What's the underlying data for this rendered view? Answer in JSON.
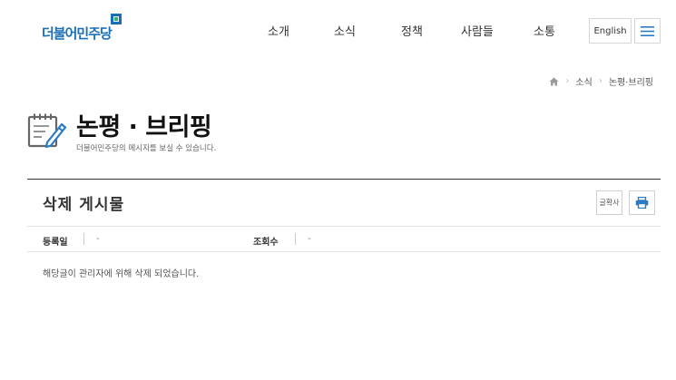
{
  "header": {
    "logo_text": "더불어민주당",
    "nav": [
      "소개",
      "소식",
      "정책",
      "사람들",
      "소통"
    ],
    "lang_label": "English",
    "menu_icon": "hamburger-icon"
  },
  "breadcrumb": {
    "home_icon": "home-icon",
    "items": [
      "소식",
      "논평·브리핑"
    ]
  },
  "page": {
    "title": "논평 · 브리핑",
    "description": "더불어민주당의 메시지를 보실 수 있습니다.",
    "title_icon": "notepad-pencil-icon"
  },
  "post": {
    "title": "삭제 게시물",
    "font_button_label": "글확사",
    "print_icon": "printer-icon",
    "date_label": "등록일",
    "date_value": "-",
    "views_label": "조회수",
    "views_value": "-",
    "body": "해당글이 관리자에 위해 삭제 되었습니다."
  },
  "colors": {
    "brand_blue": "#1a6fb7",
    "brand_green": "#2bb673",
    "icon_blue": "#2a7bc4",
    "rule_dark": "#333333"
  }
}
